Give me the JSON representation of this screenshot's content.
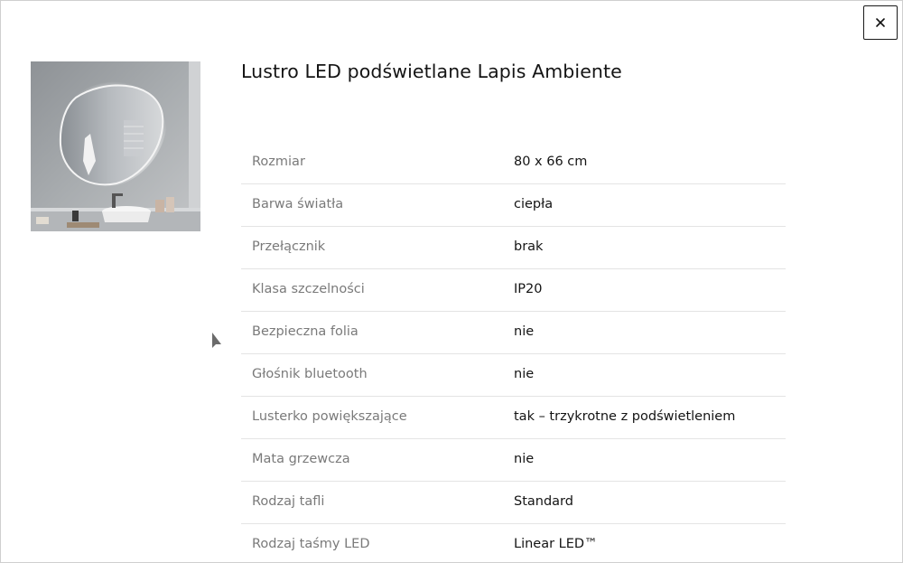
{
  "modal": {
    "title": "Lustro LED podświetlane Lapis Ambiente",
    "close_label": "×"
  },
  "image": {
    "subject": "bathroom LED mirror with ambient backlight above a round washbasin"
  },
  "specs": [
    {
      "label": "Rozmiar",
      "value": "80 x 66 cm"
    },
    {
      "label": "Barwa światła",
      "value": "ciepła"
    },
    {
      "label": "Przełącznik",
      "value": "brak"
    },
    {
      "label": "Klasa szczelności",
      "value": "IP20"
    },
    {
      "label": "Bezpieczna folia",
      "value": "nie"
    },
    {
      "label": "Głośnik bluetooth",
      "value": "nie"
    },
    {
      "label": "Lusterko powiększające",
      "value": "tak – trzykrotne z podświetleniem"
    },
    {
      "label": "Mata grzewcza",
      "value": "nie"
    },
    {
      "label": "Rodzaj tafli",
      "value": "Standard"
    },
    {
      "label": "Rodzaj taśmy LED",
      "value": "Linear LED™"
    }
  ]
}
